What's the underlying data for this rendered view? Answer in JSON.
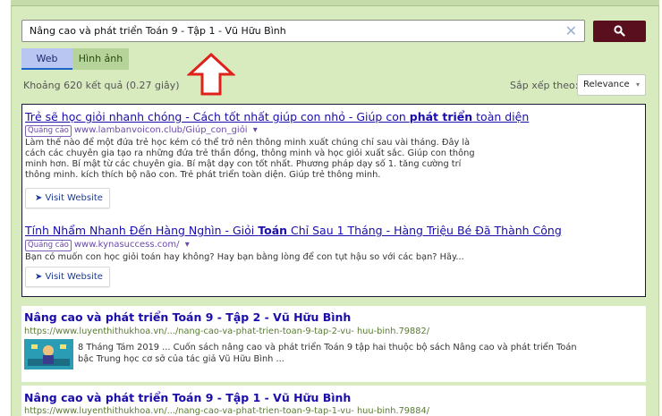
{
  "search": {
    "query": "Nâng cao và phát triển Toán 9 - Tập 1 - Vũ Hữu Bình",
    "clear_symbol": "✕"
  },
  "tabs": [
    {
      "label": "Web",
      "active": true
    },
    {
      "label": "Hình ảnh",
      "active": false
    }
  ],
  "results_info": {
    "count_text": "Khoảng 620 kết quả (0.27 giây)",
    "sort_label": "Sắp xếp theo:",
    "sort_value": "Relevance",
    "sort_caret": "▾"
  },
  "ads": [
    {
      "title": "Trẻ sẽ học giỏi nhanh chóng - Cách tốt nhất giúp con nhỏ - Giúp con ",
      "title_bold": "phát triển",
      "title_tail": " toàn diện",
      "badge": "Quảng cáo",
      "url": "www.lambanvoicon.club/Giúp_con_giỏi",
      "url_caret": "▾",
      "desc_lines": [
        "Làm thế nào để một đứa trẻ học kém có thể trở nên thông minh xuất chúng chỉ sau vài tháng. Đây là",
        "cách các chuyên gia tạo ra những đứa trẻ thần đồng, thông minh và học giỏi xuất sắc. Giúp con thông",
        "minh hơn. Bí mật từ các chuyên gia. Bí mật dạy con tốt nhất. Phương pháp dạy số 1. tăng cường trí",
        "thông minh. kích thích bộ não con. Trẻ phát triển toàn diện. Giúp trẻ thông minh."
      ],
      "visit_label": "➤ Visit Website"
    },
    {
      "title": "Tính Nhẩm Nhanh Đến Hàng Nghìn - Giỏi ",
      "title_bold": "Toán",
      "title_tail": " Chỉ Sau 1 Tháng - Hàng Triệu Bé Đã Thành Công",
      "badge": "Quảng cáo",
      "url": "www.kynasuccess.com/",
      "url_caret": "▾",
      "desc_lines": [
        "Bạn có muốn con học giỏi toán hay không? Hay bạn bằng lòng để con tụt hậu so với các bạn? Hãy..."
      ],
      "visit_label": "➤ Visit Website"
    }
  ],
  "results": [
    {
      "title": "Nâng cao và phát triển Toán 9 - Tập 2 - Vũ Hữu Bình",
      "url": "https://www.luyenthithukhoa.vn/.../nang-cao-va-phat-trien-toan-9-tap-2-vu- huu-binh.79882/",
      "snippet_lines": [
        "8 Tháng Tám 2019 ... Cuốn sách nâng cao và phát triển Toán 9 tập hai thuộc bộ sách Nâng cao và phát triển Toán",
        "bậc Trung học cơ sở của tác giả Vũ Hữu Bình ..."
      ]
    },
    {
      "title": "Nâng cao và phát triển Toán 9 - Tập 1 - Vũ Hữu Bình",
      "url": "https://www.luyenthithukhoa.vn/.../nang-cao-va-phat-trien-toan-9-tap-1-vu- huu-binh.79884/",
      "snippet_lines": []
    }
  ],
  "colors": {
    "frame_bg": "#d7ebbf",
    "search_button": "#5a0f1f",
    "link": "#1a0dab",
    "result_url": "#5a7a35",
    "ad_badge": "#6a4aa8",
    "annotation_arrow": "#e0201a"
  },
  "icons": {
    "search_button": "search-icon",
    "clear": "close-icon",
    "annotation": "up-arrow-icon"
  }
}
